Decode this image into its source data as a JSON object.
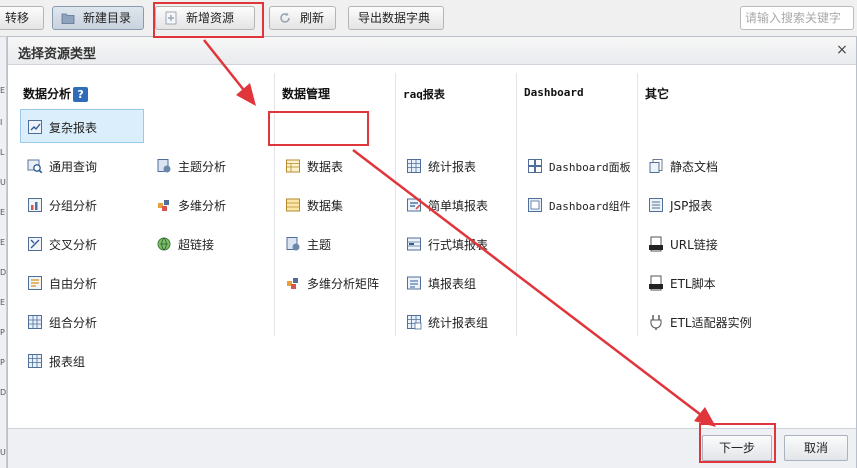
{
  "toolbar": {
    "buttons": [
      {
        "label": "转移",
        "icon": "transfer-icon"
      },
      {
        "label": "新建目录",
        "icon": "folder-icon"
      },
      {
        "label": "新增资源",
        "icon": "add-resource-icon"
      },
      {
        "label": "刷新",
        "icon": "refresh-icon"
      },
      {
        "label": "导出数据字典"
      }
    ],
    "search": {
      "placeholder": "请输入搜索关键字",
      "value": ""
    }
  },
  "left_strip": {
    "letters": [
      "E",
      "I",
      "L",
      "U",
      "E",
      "E",
      "D",
      "E",
      "P",
      "P",
      "D",
      "U"
    ]
  },
  "dialog": {
    "title": "选择资源类型",
    "close_label": "×",
    "columns": [
      {
        "title": "数据分析",
        "help": "?",
        "items": [
          {
            "label": "复杂报表",
            "icon": "complex-report-icon",
            "selected": true
          },
          {
            "label": "通用查询",
            "icon": "query-icon"
          },
          {
            "label": "分组分析",
            "icon": "group-analysis-icon"
          },
          {
            "label": "交叉分析",
            "icon": "cross-analysis-icon"
          },
          {
            "label": "自由分析",
            "icon": "free-analysis-icon"
          },
          {
            "label": "组合分析",
            "icon": "combined-analysis-icon"
          },
          {
            "label": "报表组",
            "icon": "report-group-icon"
          }
        ]
      },
      {
        "title": "",
        "items": [
          {
            "label": "主题分析",
            "icon": "topic-analysis-icon"
          },
          {
            "label": "多维分析",
            "icon": "multidim-analysis-icon"
          },
          {
            "label": "超链接",
            "icon": "hyperlink-icon"
          }
        ]
      },
      {
        "title": "数据管理",
        "items": [
          {
            "label": "数据表",
            "icon": "data-table-icon"
          },
          {
            "label": "数据集",
            "icon": "dataset-icon"
          },
          {
            "label": "主题",
            "icon": "topic-icon"
          },
          {
            "label": "多维分析矩阵",
            "icon": "matrix-icon"
          }
        ]
      },
      {
        "title": "raq报表",
        "items": [
          {
            "label": "统计报表",
            "icon": "stat-report-icon"
          },
          {
            "label": "简单填报表",
            "icon": "simple-fill-report-icon"
          },
          {
            "label": "行式填报表",
            "icon": "row-fill-report-icon"
          },
          {
            "label": "填报表组",
            "icon": "fill-report-group-icon"
          },
          {
            "label": "统计报表组",
            "icon": "stat-report-group-icon"
          }
        ]
      },
      {
        "title": "Dashboard",
        "items": [
          {
            "label": "Dashboard面板",
            "icon": "dashboard-panel-icon"
          },
          {
            "label": "Dashboard组件",
            "icon": "dashboard-widget-icon"
          }
        ]
      },
      {
        "title": "其它",
        "items": [
          {
            "label": "静态文档",
            "icon": "static-doc-icon"
          },
          {
            "label": "JSP报表",
            "icon": "jsp-report-icon"
          },
          {
            "label": "URL链接",
            "icon": "url-link-icon"
          },
          {
            "label": "ETL脚本",
            "icon": "etl-script-icon"
          },
          {
            "label": "ETL适配器实例",
            "icon": "etl-adapter-icon"
          }
        ]
      }
    ],
    "footer": {
      "next_label": "下一步",
      "cancel_label": "取消"
    }
  },
  "colors": {
    "annotation": "#e0353b",
    "selected_bg": "#dbeefb",
    "help_blue": "#2f6db8"
  }
}
